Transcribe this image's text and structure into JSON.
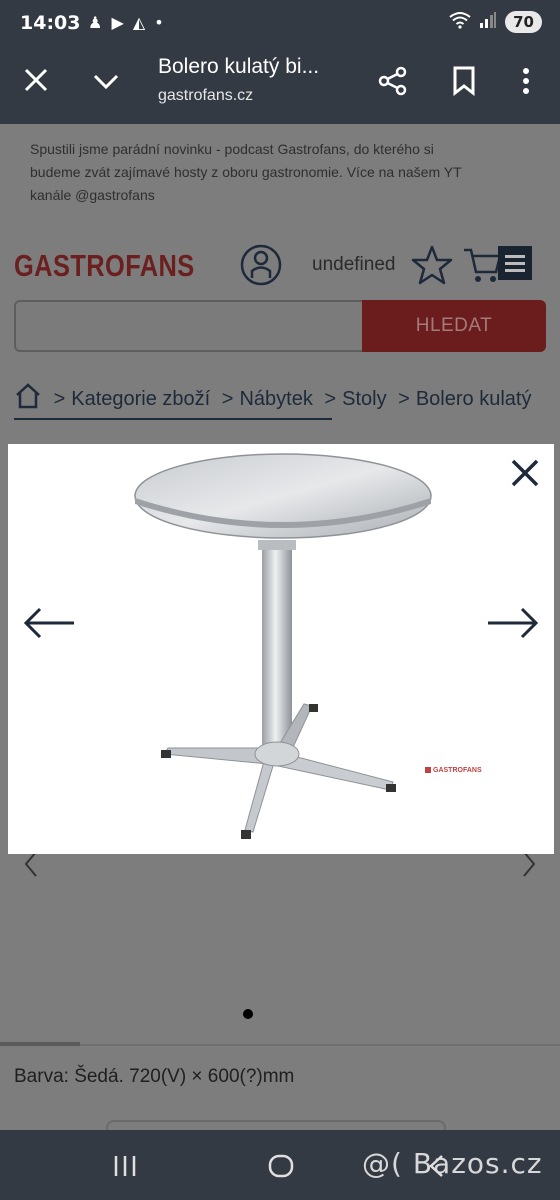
{
  "status_bar": {
    "time": "14:03",
    "battery": "70"
  },
  "browser": {
    "title": "Bolero kulatý bi...",
    "url": "gastrofans.cz"
  },
  "page": {
    "announcement": "Spustili jsme parádní novinku - podcast Gastrofans, do kterého si budeme zvát zajímavé hosty z oboru gastronomie. Více na našem YT kanále @gastrofans",
    "logo_text": "GASTROFANS",
    "user_label": "undefined",
    "search": {
      "placeholder": "",
      "button_label": "HLEDAT"
    },
    "breadcrumb": [
      "Kategorie zboží",
      "Nábytek",
      "Stoly",
      "Bolero kulatý"
    ],
    "description": "Barva: Šedá. 720(V) × 600(?)mm"
  },
  "lightbox": {
    "watermark": "GASTROFANS"
  },
  "watermark_bottom": "@( Bazos.cz",
  "colors": {
    "system_bar": "#343a44",
    "brand_red": "#6b1d1d",
    "navy": "#1e2a3a",
    "overlay_gray": "#7d7d7d"
  }
}
